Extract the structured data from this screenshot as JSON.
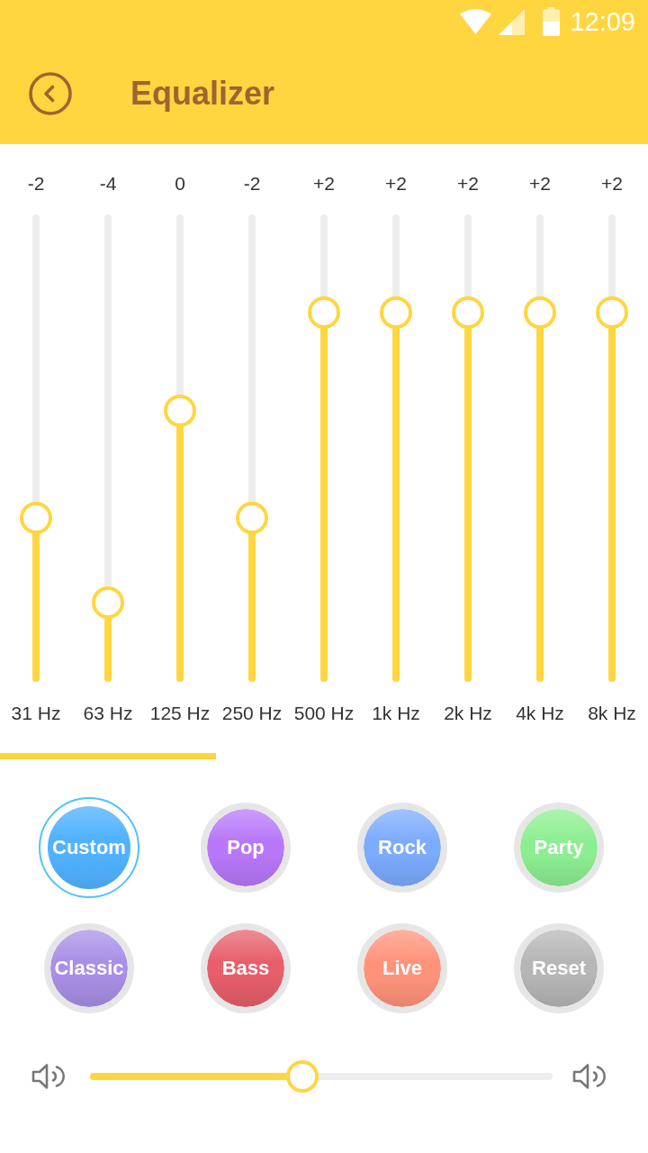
{
  "status_bar": {
    "time": "12:09"
  },
  "header": {
    "title": "Equalizer"
  },
  "bands": [
    {
      "value": "-2",
      "frequency": "31 Hz",
      "level": 0.35
    },
    {
      "value": "-4",
      "frequency": "63 Hz",
      "level": 0.17
    },
    {
      "value": "0",
      "frequency": "125 Hz",
      "level": 0.58
    },
    {
      "value": "-2",
      "frequency": "250 Hz",
      "level": 0.35
    },
    {
      "value": "+2",
      "frequency": "500 Hz",
      "level": 0.79
    },
    {
      "value": "+2",
      "frequency": "1k Hz",
      "level": 0.79
    },
    {
      "value": "+2",
      "frequency": "2k Hz",
      "level": 0.79
    },
    {
      "value": "+2",
      "frequency": "4k Hz",
      "level": 0.79
    },
    {
      "value": "+2",
      "frequency": "8k Hz",
      "level": 0.79
    }
  ],
  "presets": [
    {
      "label": "Custom",
      "selected": true,
      "color": "#50b2ff"
    },
    {
      "label": "Pop",
      "selected": false,
      "color": "#b877f9"
    },
    {
      "label": "Rock",
      "selected": false,
      "color": "#7cabff"
    },
    {
      "label": "Party",
      "selected": false,
      "color": "#8dee91"
    },
    {
      "label": "Classic",
      "selected": false,
      "color": "#a88fe7"
    },
    {
      "label": "Bass",
      "selected": false,
      "color": "#e65f6b"
    },
    {
      "label": "Live",
      "selected": false,
      "color": "#ff937a"
    },
    {
      "label": "Reset",
      "selected": false,
      "color": "#b6b6b6"
    }
  ],
  "volume": {
    "level": 0.46
  }
}
